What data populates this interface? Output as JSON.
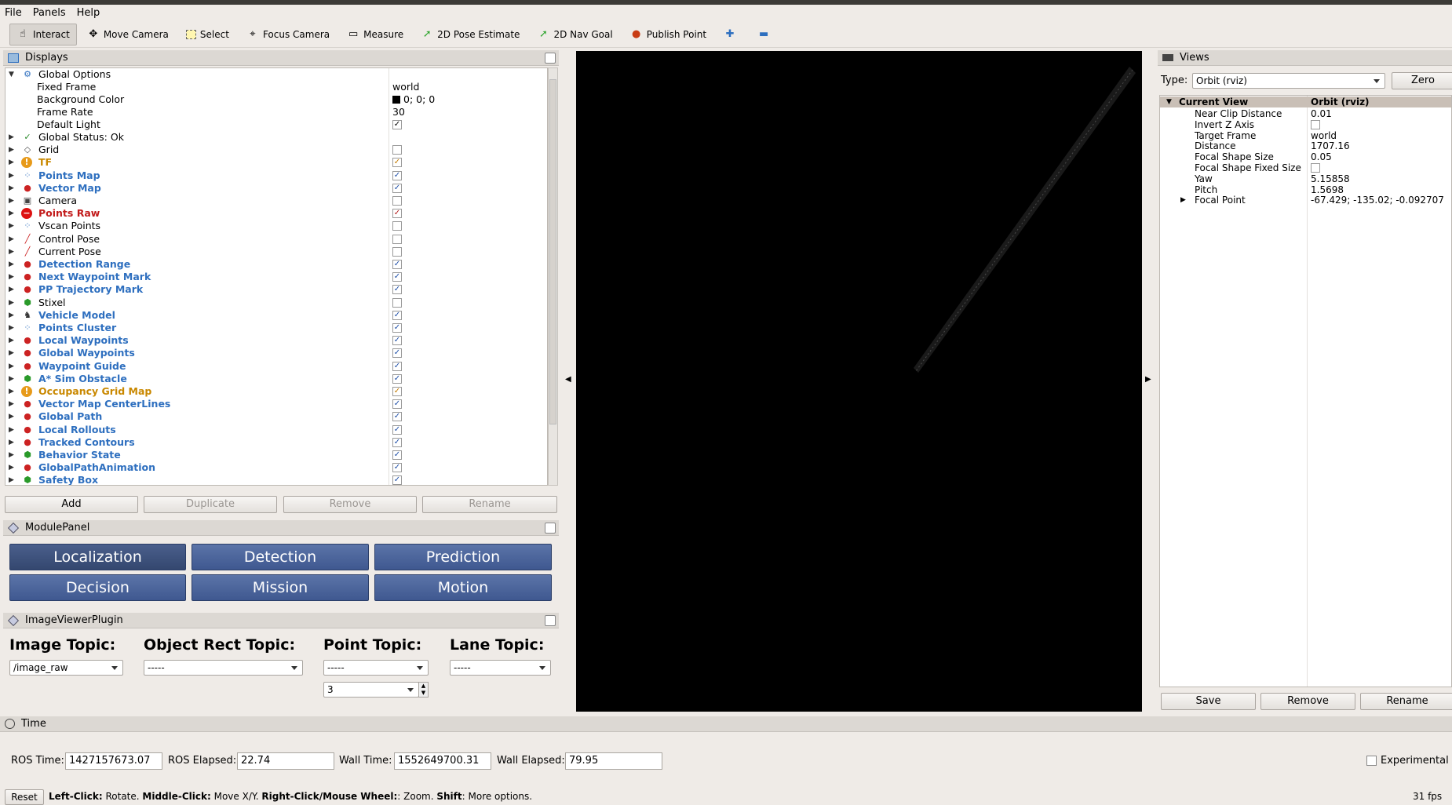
{
  "menu": [
    "File",
    "Panels",
    "Help"
  ],
  "toolbar": [
    {
      "label": "Interact",
      "icon": "interact-icon",
      "active": true
    },
    {
      "label": "Move Camera",
      "icon": "move-camera-icon"
    },
    {
      "label": "Select",
      "icon": "select-icon"
    },
    {
      "label": "Focus Camera",
      "icon": "focus-camera-icon"
    },
    {
      "label": "Measure",
      "icon": "measure-icon"
    },
    {
      "label": "2D Pose Estimate",
      "icon": "pose-arrow-icon"
    },
    {
      "label": "2D Nav Goal",
      "icon": "nav-arrow-icon"
    },
    {
      "label": "Publish Point",
      "icon": "map-pin-icon"
    }
  ],
  "displays": {
    "title": "Displays",
    "global_options": {
      "label": "Global Options",
      "fixed_frame": {
        "label": "Fixed Frame",
        "value": "world"
      },
      "background_color": {
        "label": "Background Color",
        "value": "0; 0; 0"
      },
      "frame_rate": {
        "label": "Frame Rate",
        "value": "30"
      },
      "default_light": {
        "label": "Default Light"
      }
    },
    "items": [
      {
        "label": "Global Status: Ok",
        "style": "normal",
        "check": null
      },
      {
        "label": "Grid",
        "style": "normal",
        "check": false
      },
      {
        "label": "TF",
        "style": "orange",
        "check": true
      },
      {
        "label": "Points Map",
        "style": "blue",
        "check": true
      },
      {
        "label": "Vector Map",
        "style": "blue",
        "check": true
      },
      {
        "label": "Camera",
        "style": "normal",
        "check": false
      },
      {
        "label": "Points Raw",
        "style": "red",
        "check": true
      },
      {
        "label": "Vscan Points",
        "style": "normal",
        "check": false
      },
      {
        "label": "Control Pose",
        "style": "normal",
        "check": false
      },
      {
        "label": "Current Pose",
        "style": "normal",
        "check": false
      },
      {
        "label": "Detection Range",
        "style": "blue",
        "check": true
      },
      {
        "label": "Next Waypoint Mark",
        "style": "blue",
        "check": true
      },
      {
        "label": "PP Trajectory Mark",
        "style": "blue",
        "check": true
      },
      {
        "label": "Stixel",
        "style": "normal",
        "check": false
      },
      {
        "label": "Vehicle Model",
        "style": "blue",
        "check": true
      },
      {
        "label": "Points Cluster",
        "style": "blue",
        "check": true
      },
      {
        "label": "Local Waypoints",
        "style": "blue",
        "check": true
      },
      {
        "label": "Global Waypoints",
        "style": "blue",
        "check": true
      },
      {
        "label": "Waypoint Guide",
        "style": "blue",
        "check": true
      },
      {
        "label": "A* Sim Obstacle",
        "style": "blue",
        "check": true
      },
      {
        "label": "Occupancy Grid Map",
        "style": "orange",
        "check": true
      },
      {
        "label": "Vector Map CenterLines",
        "style": "blue",
        "check": true
      },
      {
        "label": "Global Path",
        "style": "blue",
        "check": true
      },
      {
        "label": "Local Rollouts",
        "style": "blue",
        "check": true
      },
      {
        "label": "Tracked Contours",
        "style": "blue",
        "check": true
      },
      {
        "label": "Behavior State",
        "style": "blue",
        "check": true
      },
      {
        "label": "GlobalPathAnimation",
        "style": "blue",
        "check": true
      },
      {
        "label": "Safety Box",
        "style": "blue",
        "check": true
      }
    ],
    "buttons": {
      "add": "Add",
      "duplicate": "Duplicate",
      "remove": "Remove",
      "rename": "Rename"
    }
  },
  "module_panel": {
    "title": "ModulePanel",
    "buttons": [
      "Localization",
      "Detection",
      "Prediction",
      "Decision",
      "Mission",
      "Motion"
    ]
  },
  "image_viewer": {
    "title": "ImageViewerPlugin",
    "image_topic": {
      "label": "Image Topic:",
      "value": "/image_raw"
    },
    "object_rect_topic": {
      "label": "Object Rect Topic:",
      "value": "-----"
    },
    "point_topic": {
      "label": "Point Topic:",
      "value": "-----",
      "spin": "3"
    },
    "lane_topic": {
      "label": "Lane Topic:",
      "value": "-----"
    }
  },
  "views": {
    "title": "Views",
    "type_label": "Type:",
    "type_value": "Orbit (rviz)",
    "zero": "Zero",
    "current_view": {
      "label": "Current View",
      "value": "Orbit (rviz)"
    },
    "props": [
      {
        "key": "Near Clip Distance",
        "value": "0.01"
      },
      {
        "key": "Invert Z Axis",
        "value": ""
      },
      {
        "key": "Target Frame",
        "value": "world"
      },
      {
        "key": "Distance",
        "value": "1707.16"
      },
      {
        "key": "Focal Shape Size",
        "value": "0.05"
      },
      {
        "key": "Focal Shape Fixed Size",
        "value": ""
      },
      {
        "key": "Yaw",
        "value": "5.15858"
      },
      {
        "key": "Pitch",
        "value": "1.5698"
      },
      {
        "key": "Focal Point",
        "value": "-67.429; -135.02; -0.092707"
      }
    ],
    "buttons": {
      "save": "Save",
      "remove": "Remove",
      "rename": "Rename"
    }
  },
  "time": {
    "title": "Time",
    "ros_time": {
      "label": "ROS Time:",
      "value": "1427157673.07"
    },
    "ros_elapsed": {
      "label": "ROS Elapsed:",
      "value": "22.74"
    },
    "wall_time": {
      "label": "Wall Time:",
      "value": "1552649700.31"
    },
    "wall_elapsed": {
      "label": "Wall Elapsed:",
      "value": "79.95"
    },
    "experimental": "Experimental"
  },
  "status": {
    "reset": "Reset",
    "hint_parts": [
      "Left-Click:",
      " Rotate. ",
      "Middle-Click:",
      " Move X/Y. ",
      "Right-Click/Mouse Wheel:",
      ": Zoom. ",
      "Shift",
      ": More options."
    ],
    "fps": "31 fps"
  },
  "colors": {
    "blue_label": "#2e6fbf",
    "red_label": "#c21a1a",
    "orange_label": "#c98800",
    "module_button": "#4d66a0"
  }
}
